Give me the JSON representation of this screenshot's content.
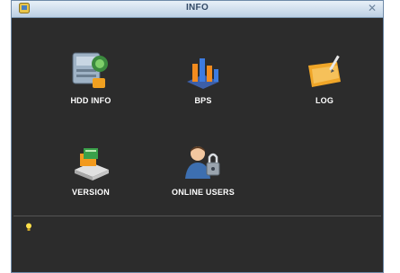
{
  "window": {
    "title": "INFO"
  },
  "menu": {
    "items": [
      {
        "label": "HDD INFO",
        "icon": "hdd-icon"
      },
      {
        "label": "BPS",
        "icon": "bps-chart-icon"
      },
      {
        "label": "LOG",
        "icon": "log-folder-icon"
      },
      {
        "label": "VERSION",
        "icon": "version-icon"
      },
      {
        "label": "ONLINE USERS",
        "icon": "online-users-icon"
      }
    ]
  },
  "status": {
    "hint": ""
  }
}
